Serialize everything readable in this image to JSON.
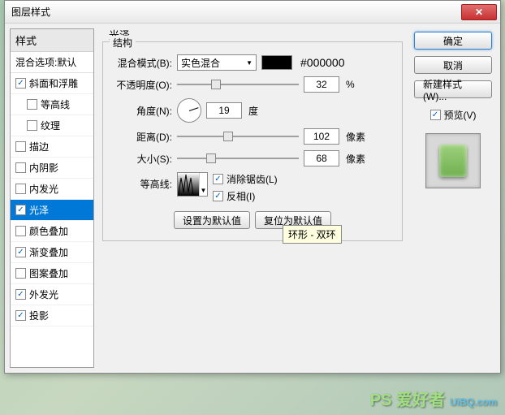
{
  "window": {
    "title": "图层样式"
  },
  "sidebar": {
    "header": "样式",
    "sub": "混合选项:默认",
    "items": [
      {
        "label": "斜面和浮雕",
        "checked": true,
        "indent": false
      },
      {
        "label": "等高线",
        "checked": false,
        "indent": true
      },
      {
        "label": "纹理",
        "checked": false,
        "indent": true
      },
      {
        "label": "描边",
        "checked": false,
        "indent": false
      },
      {
        "label": "内阴影",
        "checked": false,
        "indent": false
      },
      {
        "label": "内发光",
        "checked": false,
        "indent": false
      },
      {
        "label": "光泽",
        "checked": true,
        "indent": false,
        "selected": true
      },
      {
        "label": "颜色叠加",
        "checked": false,
        "indent": false
      },
      {
        "label": "渐变叠加",
        "checked": true,
        "indent": false
      },
      {
        "label": "图案叠加",
        "checked": false,
        "indent": false
      },
      {
        "label": "外发光",
        "checked": true,
        "indent": false
      },
      {
        "label": "投影",
        "checked": true,
        "indent": false
      }
    ]
  },
  "center": {
    "title": "光泽",
    "structure_title": "结构",
    "blend_mode_label": "混合模式(B):",
    "blend_mode_value": "实色混合",
    "color_hex": "#000000",
    "opacity_label": "不透明度(O):",
    "opacity_value": "32",
    "opacity_unit": "%",
    "angle_label": "角度(N):",
    "angle_value": "19",
    "angle_unit": "度",
    "distance_label": "距离(D):",
    "distance_value": "102",
    "distance_unit": "像素",
    "size_label": "大小(S):",
    "size_value": "68",
    "size_unit": "像素",
    "contour_label": "等高线:",
    "antialias_label": "消除锯齿(L)",
    "invert_label": "反相(I)",
    "reset_default_btn": "设置为默认值",
    "restore_default_btn": "复位为默认值",
    "tooltip": "环形 - 双环"
  },
  "right": {
    "ok": "确定",
    "cancel": "取消",
    "new_style": "新建样式(W)...",
    "preview_label": "预览(V)"
  },
  "watermark": {
    "logo": "PS 爱好者",
    "url": "UiBQ.com"
  }
}
